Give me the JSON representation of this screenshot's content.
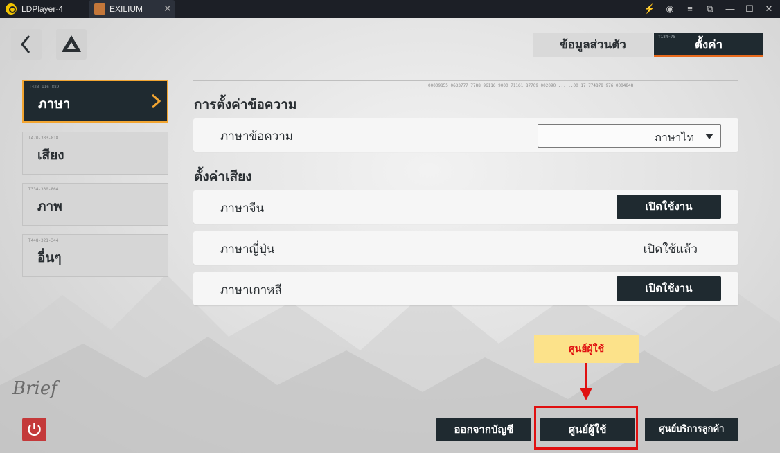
{
  "titlebar": {
    "app_name": "LDPlayer-4",
    "tab_label": "EXILIUM",
    "tab_close": "✕",
    "controls": [
      "⚡",
      "◉",
      "≡",
      "⧉",
      "—",
      "☐",
      "✕"
    ]
  },
  "tabs": {
    "profile": "ข้อมูลส่วนตัว",
    "settings": "ตั้งค่า"
  },
  "nav": {
    "items": [
      {
        "code": "T423-116-889",
        "label": "ภาษา"
      },
      {
        "code": "T470-333-818",
        "label": "เสียง"
      },
      {
        "code": "T334-330-864",
        "label": "ภาพ"
      },
      {
        "code": "T448-321-344",
        "label": "อื่นๆ"
      }
    ]
  },
  "text_settings": {
    "title": "การตั้งค่าข้อความ",
    "label": "ภาษาข้อความ",
    "value": "ภาษาไท"
  },
  "voice_settings": {
    "title": "ตั้งค่าเสียง",
    "rows": [
      {
        "label": "ภาษาจีน",
        "action": "เปิดใช้งาน"
      },
      {
        "label": "ภาษาญี่ปุ่น",
        "status": "เปิดใช้แล้ว"
      },
      {
        "label": "ภาษาเกาหลี",
        "action": "เปิดใช้งาน"
      }
    ]
  },
  "footer": {
    "logout": "ออกจากบัญชี",
    "user_center": "ศูนย์ผู้ใช้",
    "support": "ศูนย์บริการลูกค้า"
  },
  "callout": {
    "text": "ศูนย์ผู้ใช้",
    "color": "#e01010",
    "bg": "#fce28a"
  },
  "deco": {
    "tab_code": "T184-75",
    "signature": "Brief",
    "number_strip": "00009855 0633777 7788 96116 9000 71161 87709 002090 ......00 17 774878 976 0004848"
  },
  "colors": {
    "dark": "#1f2a30",
    "accent": "#f2a531",
    "tab_underline": "#e86a1c",
    "power": "#c4393a"
  }
}
